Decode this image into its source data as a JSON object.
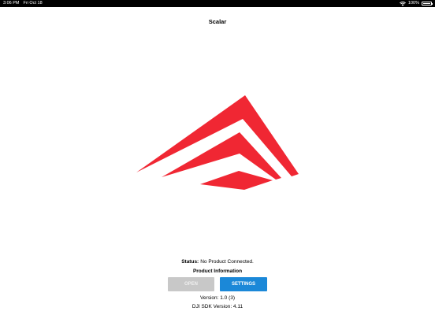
{
  "status_bar": {
    "time": "3:06 PM",
    "date": "Fri Oct 18",
    "battery": "100%",
    "wifi_icon": "wifi-icon",
    "battery_icon": "battery-icon"
  },
  "nav": {
    "title": "Scalar"
  },
  "logo": {
    "name": "app-logo",
    "color": "#f02733"
  },
  "status": {
    "label": "Status:",
    "value": "No Product Connected."
  },
  "product_info": {
    "heading": "Product Information"
  },
  "buttons": {
    "open_label": "OPEN",
    "open_enabled": false,
    "settings_label": "SETTINGS",
    "settings_color": "#1b88d8"
  },
  "version": {
    "app": "Version: 1.0 (3)",
    "sdk": "DJI SDK Version: 4.11"
  }
}
